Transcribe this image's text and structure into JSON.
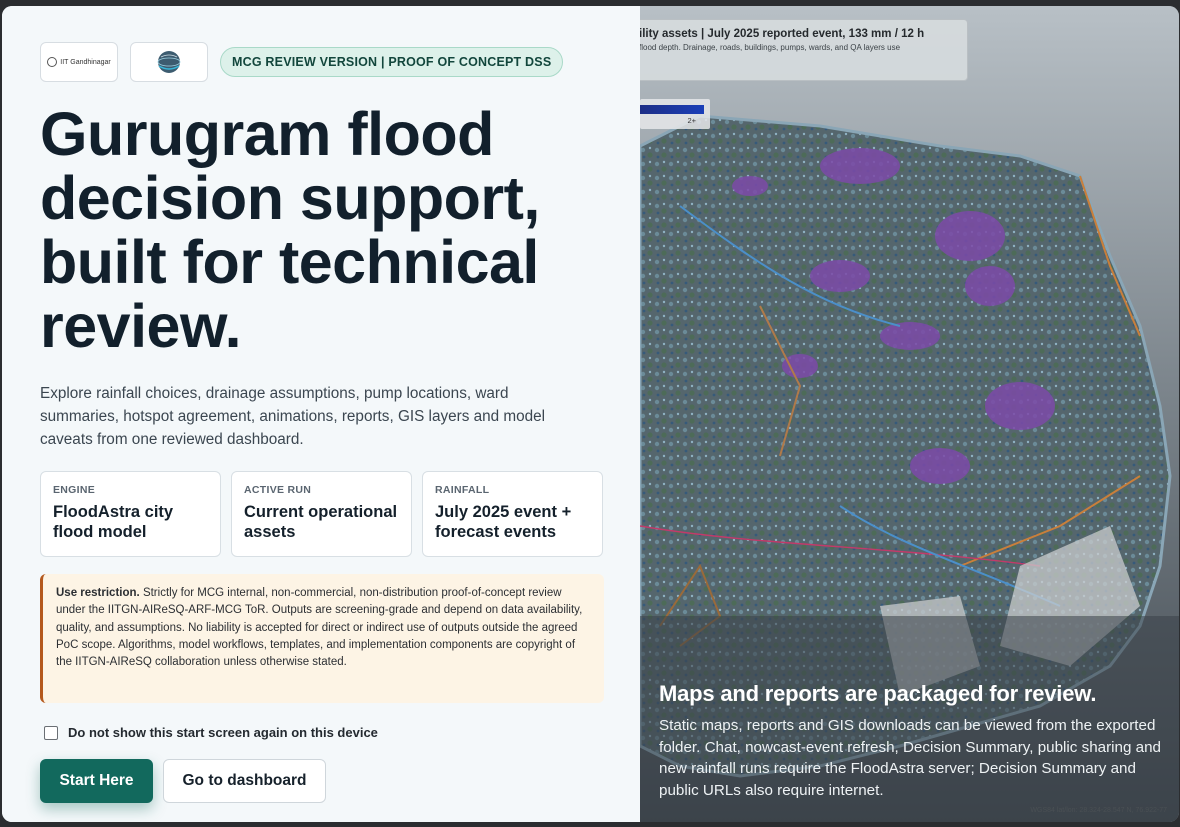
{
  "logos": {
    "iitgn_text": "IIT Gandhinagar"
  },
  "badge": "MCG REVIEW VERSION | PROOF OF CONCEPT DSS",
  "headline": "Gurugram flood decision support, built for technical review.",
  "intro": "Explore rainfall choices, drainage assumptions, pump locations, ward summaries, hotspot agreement, animations, reports, GIS layers and model caveats from one reviewed dashboard.",
  "cards": [
    {
      "label": "ENGINE",
      "value": "FloodAstra city flood model"
    },
    {
      "label": "ACTIVE RUN",
      "value": "Current operational assets"
    },
    {
      "label": "RAINFALL",
      "value": "July 2025 event + forecast events"
    }
  ],
  "restriction": {
    "title": "Use restriction.",
    "text": "Strictly for MCG internal, non-commercial, non-distribution proof-of-concept review under the IITGN-AIReSQ-ARF-MCG ToR. Outputs are screening-grade and depend on data availability, quality, and assumptions. No liability is accepted for direct or indirect use of outputs outside the agreed PoC scope. Algorithms, model workflows, templates, and implementation components are copyright of the IITGN-AIReSQ collaboration unless otherwise stated."
  },
  "checkbox": {
    "label": "Do not show this start screen again on this device",
    "checked": false
  },
  "buttons": {
    "start": "Start Here",
    "dashboard": "Go to dashboard"
  },
  "map": {
    "title": "ility assets | July 2025 reported event, 133 mm / 12 h",
    "subtitle": "flood depth. Drainage, roads, buildings, pumps, wards, and QA layers use",
    "legend_tick": "2+",
    "coords": "WGS84 lat/lon: 28.324-28.547 N, 76.922-77",
    "panel_heading": "Maps and reports are packaged for review.",
    "panel_text": "Static maps, reports and GIS downloads can be viewed from the exported folder. Chat, nowcast-event refresh, Decision Summary, public sharing and new rainfall runs require the FloodAstra server; Decision Summary and public URLs also require internet."
  },
  "colors": {
    "accent": "#12695d",
    "badge_bg": "#ddf1ea",
    "warning_border": "#b4581c",
    "warning_bg": "#fdf4e5"
  }
}
